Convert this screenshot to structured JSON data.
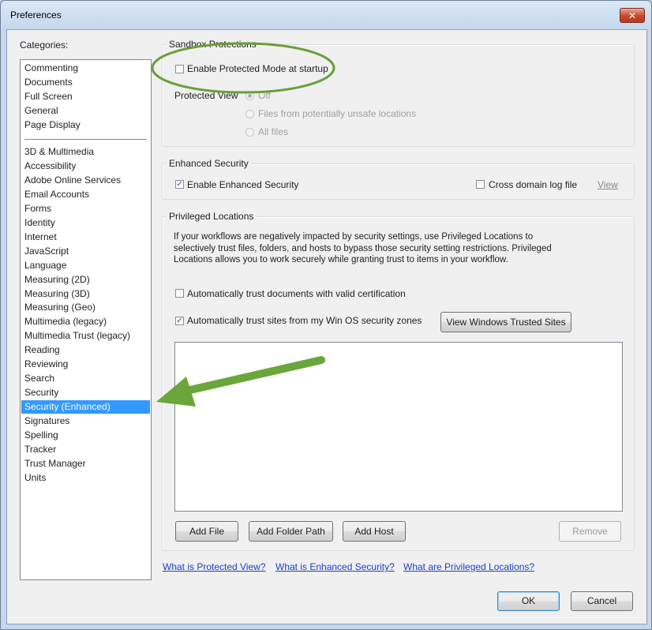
{
  "window": {
    "title": "Preferences",
    "close_glyph": "✕"
  },
  "categories": {
    "label": "Categories:",
    "group1": [
      "Commenting",
      "Documents",
      "Full Screen",
      "General",
      "Page Display"
    ],
    "group2": [
      "3D & Multimedia",
      "Accessibility",
      "Adobe Online Services",
      "Email Accounts",
      "Forms",
      "Identity",
      "Internet",
      "JavaScript",
      "Language",
      "Measuring (2D)",
      "Measuring (3D)",
      "Measuring (Geo)",
      "Multimedia (legacy)",
      "Multimedia Trust (legacy)",
      "Reading",
      "Reviewing",
      "Search",
      "Security",
      "Security (Enhanced)",
      "Signatures",
      "Spelling",
      "Tracker",
      "Trust Manager",
      "Units"
    ],
    "selected": "Security (Enhanced)"
  },
  "sandbox": {
    "legend": "Sandbox Protections",
    "protected_mode_label": "Enable Protected Mode at startup",
    "protected_mode_checked": false,
    "protected_view_label": "Protected View",
    "options": [
      "Off",
      "Files from potentially unsafe locations",
      "All files"
    ],
    "selected_option": "Off"
  },
  "enhanced": {
    "legend": "Enhanced Security",
    "enable_label": "Enable Enhanced Security",
    "enable_checked": true,
    "cross_domain_label": "Cross domain log file",
    "cross_domain_checked": false,
    "view_link": "View"
  },
  "privileged": {
    "legend": "Privileged Locations",
    "description": "If your workflows are negatively impacted by security settings, use Privileged Locations to selectively trust files, folders, and hosts to bypass those security setting restrictions. Privileged Locations allows you to work securely while granting trust to items in your workflow.",
    "auto_cert_label": "Automatically trust documents with valid certification",
    "auto_cert_checked": false,
    "auto_sites_label": "Automatically trust sites from my Win OS security zones",
    "auto_sites_checked": true,
    "view_trusted_button": "View Windows Trusted Sites",
    "add_file_button": "Add File",
    "add_folder_button": "Add Folder Path",
    "add_host_button": "Add Host",
    "remove_button": "Remove"
  },
  "links": {
    "protected_view": "What is Protected View?",
    "enhanced_security": "What is Enhanced Security?",
    "privileged_locations": "What are Privileged Locations?"
  },
  "footer": {
    "ok": "OK",
    "cancel": "Cancel"
  },
  "check_glyph": "✓",
  "colors": {
    "highlight_ellipse": "#6a9e3a",
    "arrow": "#6aa63a",
    "selection": "#3399ff"
  }
}
